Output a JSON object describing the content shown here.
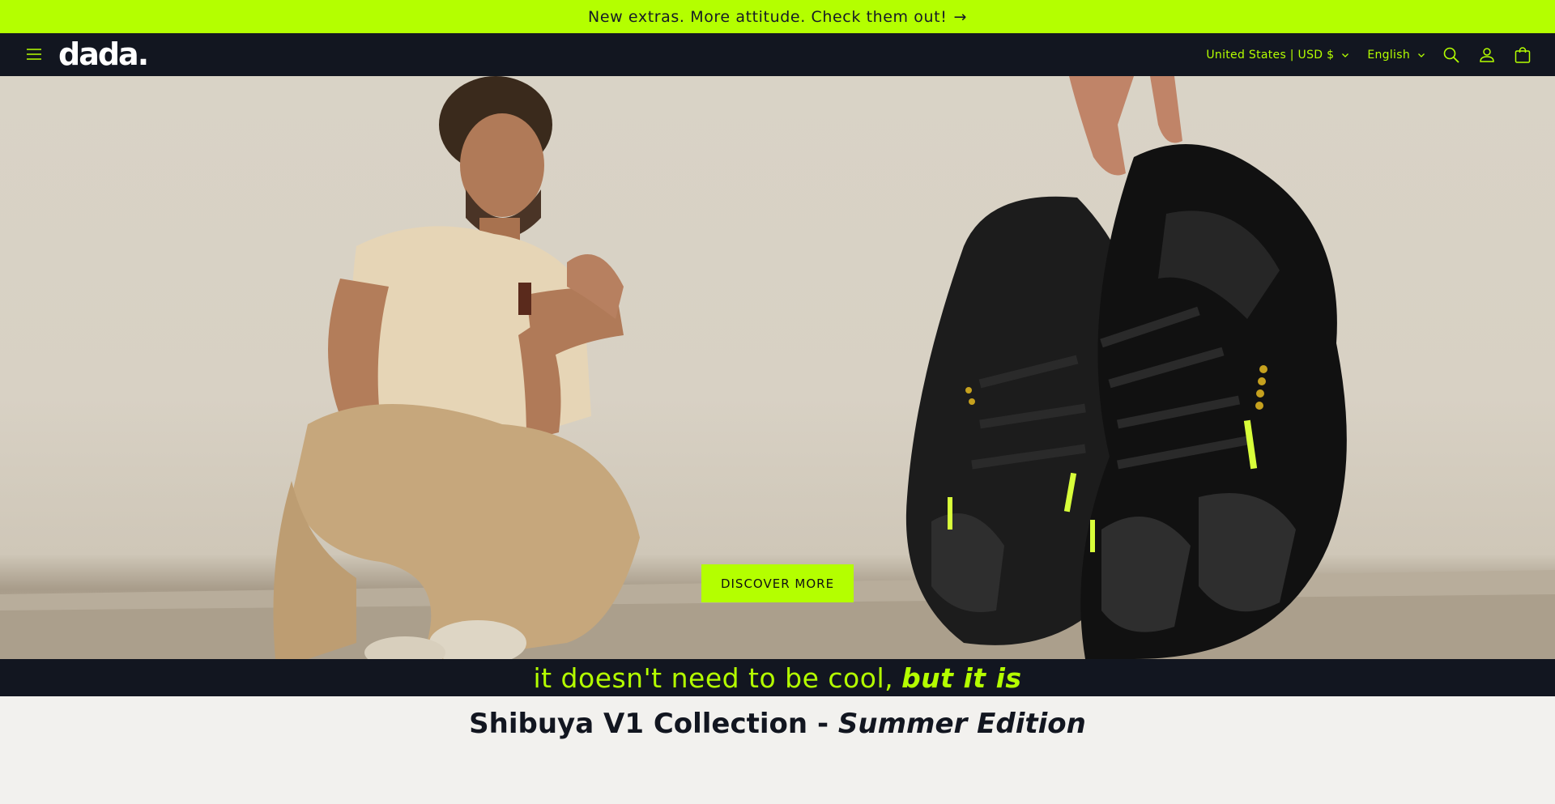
{
  "announcement": {
    "text": "New extras. More attitude. Check them out!",
    "arrow": "→"
  },
  "header": {
    "logo_text": "dada.",
    "country_selector": "United States | USD $",
    "language_selector": "English",
    "icons": [
      "menu-icon",
      "search-icon",
      "account-icon",
      "cart-icon"
    ]
  },
  "hero": {
    "cta_label": "DISCOVER MORE"
  },
  "tagline": {
    "main": "it doesn't need to be cool,",
    "emphasis": "but it is"
  },
  "collection": {
    "title": "Shibuya V1 Collection -",
    "edition": "Summer Edition"
  },
  "colors": {
    "accent": "#b4ff00",
    "dark": "#121620",
    "page_bg": "#f2f1ee"
  }
}
